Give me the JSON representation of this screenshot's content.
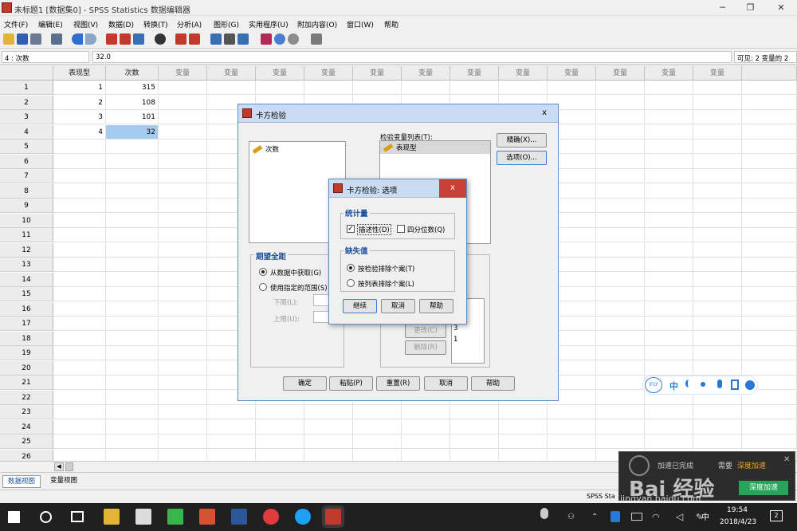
{
  "window": {
    "title": "未标题1 [数据集0] - SPSS Statistics 数据编辑器",
    "minimize_glyph": "─",
    "restore_glyph": "❐",
    "close_glyph": "✕"
  },
  "menu": [
    "文件(F)",
    "编辑(E)",
    "视图(V)",
    "数据(D)",
    "转换(T)",
    "分析(A)",
    "图形(G)",
    "实用程序(U)",
    "附加内容(O)",
    "窗口(W)",
    "帮助"
  ],
  "toolbar_icons": [
    "open-icon",
    "save-icon",
    "print-icon",
    "dialog-recall-icon",
    "undo-icon",
    "redo-icon",
    "goto-case-icon",
    "goto-variable-icon",
    "variables-icon",
    "find-icon",
    "insert-cases-icon",
    "insert-variable-icon",
    "split-file-icon",
    "weight-cases-icon",
    "select-cases-icon",
    "value-labels-icon",
    "use-sets-icon",
    "show-all-variables-icon",
    "spell-check-icon"
  ],
  "cell_editor": {
    "reference": "4 : 次数",
    "value": "32.0",
    "visible": "可见: 2 变量的 2"
  },
  "grid": {
    "columns": [
      "表现型",
      "次数",
      "变量",
      "变量",
      "变量",
      "变量",
      "变量",
      "变量",
      "变量",
      "变量",
      "变量",
      "变量",
      "变量",
      "变量"
    ],
    "row_numbers": [
      "1",
      "2",
      "3",
      "4",
      "5",
      "6",
      "7",
      "8",
      "9",
      "10",
      "11",
      "12",
      "13",
      "14",
      "15",
      "16",
      "17",
      "18",
      "19",
      "20",
      "21",
      "22",
      "23",
      "24",
      "25",
      "26"
    ],
    "rows": [
      [
        "1",
        "315"
      ],
      [
        "2",
        "108"
      ],
      [
        "3",
        "101"
      ],
      [
        "4",
        "32"
      ]
    ],
    "selected": "4 : 次数"
  },
  "view_tabs": [
    "数据视图",
    "变量视图"
  ],
  "status_text": "SPSS Sta",
  "chi_dialog": {
    "title": "卡方检验",
    "close": "x",
    "source_vars": [
      "次数"
    ],
    "test_list_label": "检验变量列表(T):",
    "test_vars": [
      "表现型"
    ],
    "exact_button": "精确(X)...",
    "options_button": "选项(O)...",
    "expected_range_title": "期望全距",
    "radio_from_data": "从数据中获取(G)",
    "radio_use_range": "使用指定的范围(S)",
    "lower_label": "下限(L):",
    "upper_label": "上限(U):",
    "expected_values_list": [
      "3",
      "1"
    ],
    "change_button": "更改(C)",
    "remove_button": "删除(R)",
    "ok": "确定",
    "paste": "粘贴(P)",
    "reset": "重置(R)",
    "cancel": "取消",
    "help": "帮助"
  },
  "options_dialog": {
    "title": "卡方检验: 选项",
    "close": "x",
    "statistics_title": "统计量",
    "descriptive": "描述性(D)",
    "quartiles": "四分位数(Q)",
    "missing_title": "缺失值",
    "exclude_test": "按检验排除个案(T)",
    "exclude_listwise": "按列表排除个案(L)",
    "continue": "继续",
    "cancel": "取消",
    "help": "帮助",
    "descriptive_checked": true,
    "quartiles_checked": false
  },
  "ime_toolbar": {
    "brand": "iFLY",
    "mode": "中"
  },
  "notification": {
    "text": "加速已完成",
    "label": "需要",
    "highlight": "深度加速",
    "action": "深度加速",
    "close": "✕",
    "brand": "Bai 经验",
    "url": "jingyan.baidu.com"
  },
  "taskbar": {
    "time": "19:54",
    "date": "2018/4/23",
    "input": "中",
    "notif_count": "2"
  },
  "colors": {
    "selection": "#a6cbef",
    "title_blue": "#1a4e9c",
    "dialog_title": "#c9dcf1",
    "close_red": "#c9403a",
    "taskbar": "#202020"
  }
}
